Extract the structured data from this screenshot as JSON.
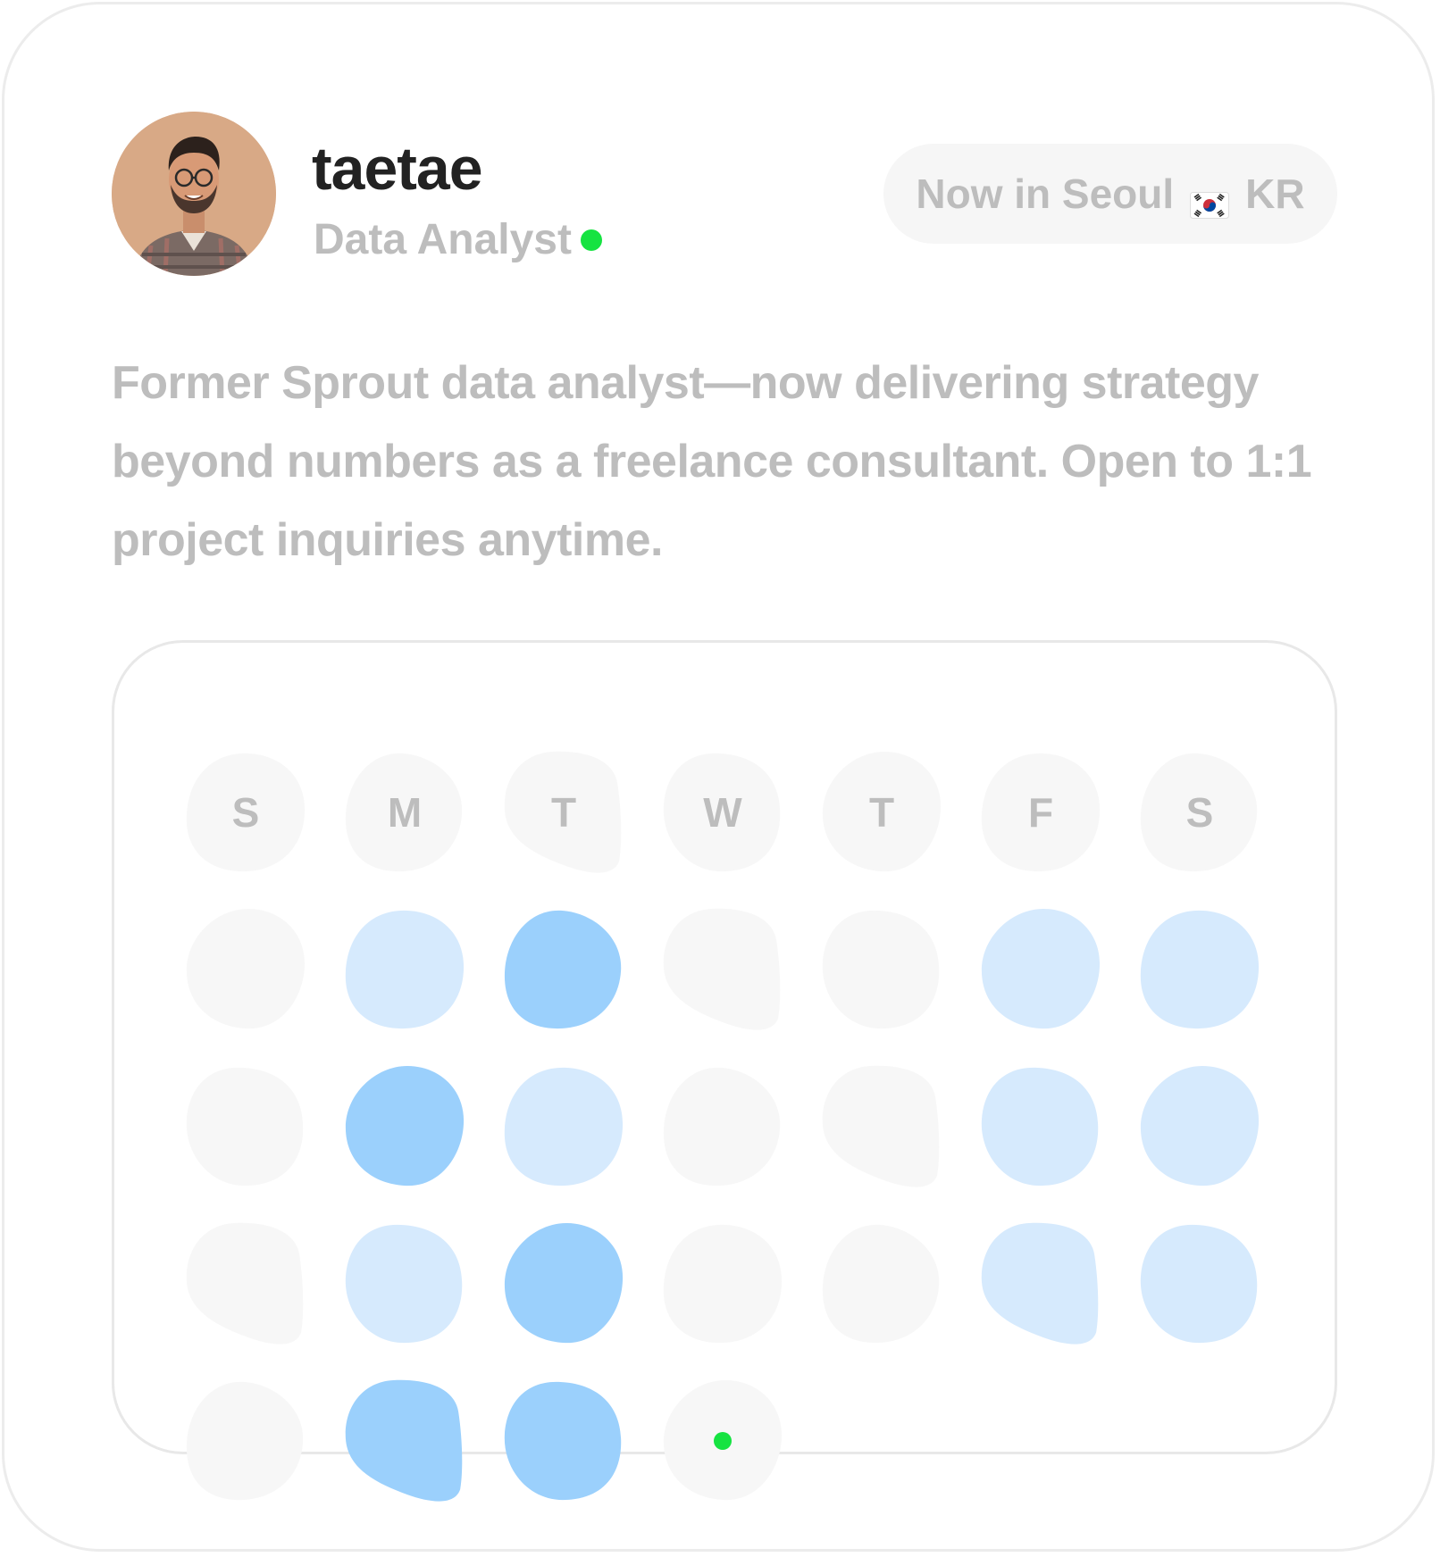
{
  "profile": {
    "username": "taetae",
    "role": "Data Analyst",
    "status": "online",
    "location": {
      "label": "Now in Seoul",
      "flag_icon": "south-korea-flag-icon",
      "country_code": "KR"
    },
    "bio": "Former Sprout data analyst—now delivering strategy beyond numbers as a freelance consultant. Open to 1:1 project inquiries anytime."
  },
  "calendar": {
    "weekday_labels": [
      "S",
      "M",
      "T",
      "W",
      "T",
      "F",
      "S"
    ],
    "intensity_levels": {
      "0": "none",
      "1": "light",
      "2": "medium"
    },
    "weeks": [
      [
        0,
        1,
        2,
        0,
        0,
        1,
        1
      ],
      [
        0,
        2,
        1,
        0,
        0,
        1,
        1
      ],
      [
        0,
        1,
        2,
        0,
        0,
        1,
        1
      ],
      [
        0,
        2,
        2,
        0
      ]
    ],
    "today": {
      "week": 3,
      "day": 3
    },
    "colors": {
      "none": "#f7f7f7",
      "light": "#d6eafd",
      "medium": "#9bd0fc",
      "today_dot": "#16e341",
      "online_dot": "#16e341"
    }
  }
}
